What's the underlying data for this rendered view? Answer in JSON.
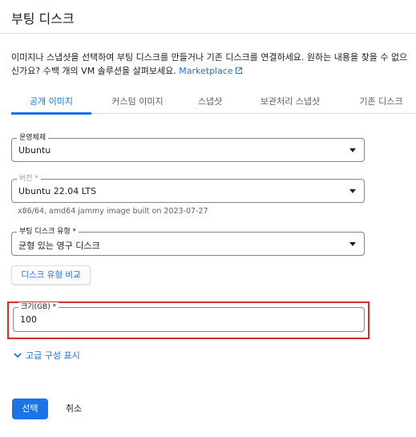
{
  "dialog": {
    "title": "부팅 디스크"
  },
  "description": {
    "text": "이미지나 스냅샷을 선택하여 부팅 디스크를 만들거나 기존 디스크를 연결하세요. 원하는 내용을 찾을 수 없으신가요? 수백 개의 VM 솔루션을 살펴보세요.",
    "link": "Marketplace"
  },
  "tabs": [
    {
      "label": "공개 이미지",
      "active": true
    },
    {
      "label": "커스텀 이미지",
      "active": false
    },
    {
      "label": "스냅샷",
      "active": false
    },
    {
      "label": "보관처리 스냅샷",
      "active": false
    },
    {
      "label": "기존 디스크",
      "active": false
    }
  ],
  "os_field": {
    "label": "운영체제",
    "value": "Ubuntu"
  },
  "version_field": {
    "label": "버전 *",
    "value": "Ubuntu 22.04 LTS",
    "hint": "x86/64, amd64 jammy image built on 2023-07-27"
  },
  "disk_type_field": {
    "label": "부팅 디스크 유형 *",
    "value": "균형 있는 영구 디스크"
  },
  "compare_button": "디스크 유형 비교",
  "size_field": {
    "label": "크기(GB) *",
    "value": "100"
  },
  "advanced_link": "고급 구성 표시",
  "actions": {
    "select": "선택",
    "cancel": "취소"
  },
  "colors": {
    "accent": "#1a73e8",
    "highlight": "#d32f2f"
  },
  "icons": {
    "external": "external-link-icon",
    "expand": "chevron-down-icon",
    "dropdown": "caret-down-icon"
  }
}
